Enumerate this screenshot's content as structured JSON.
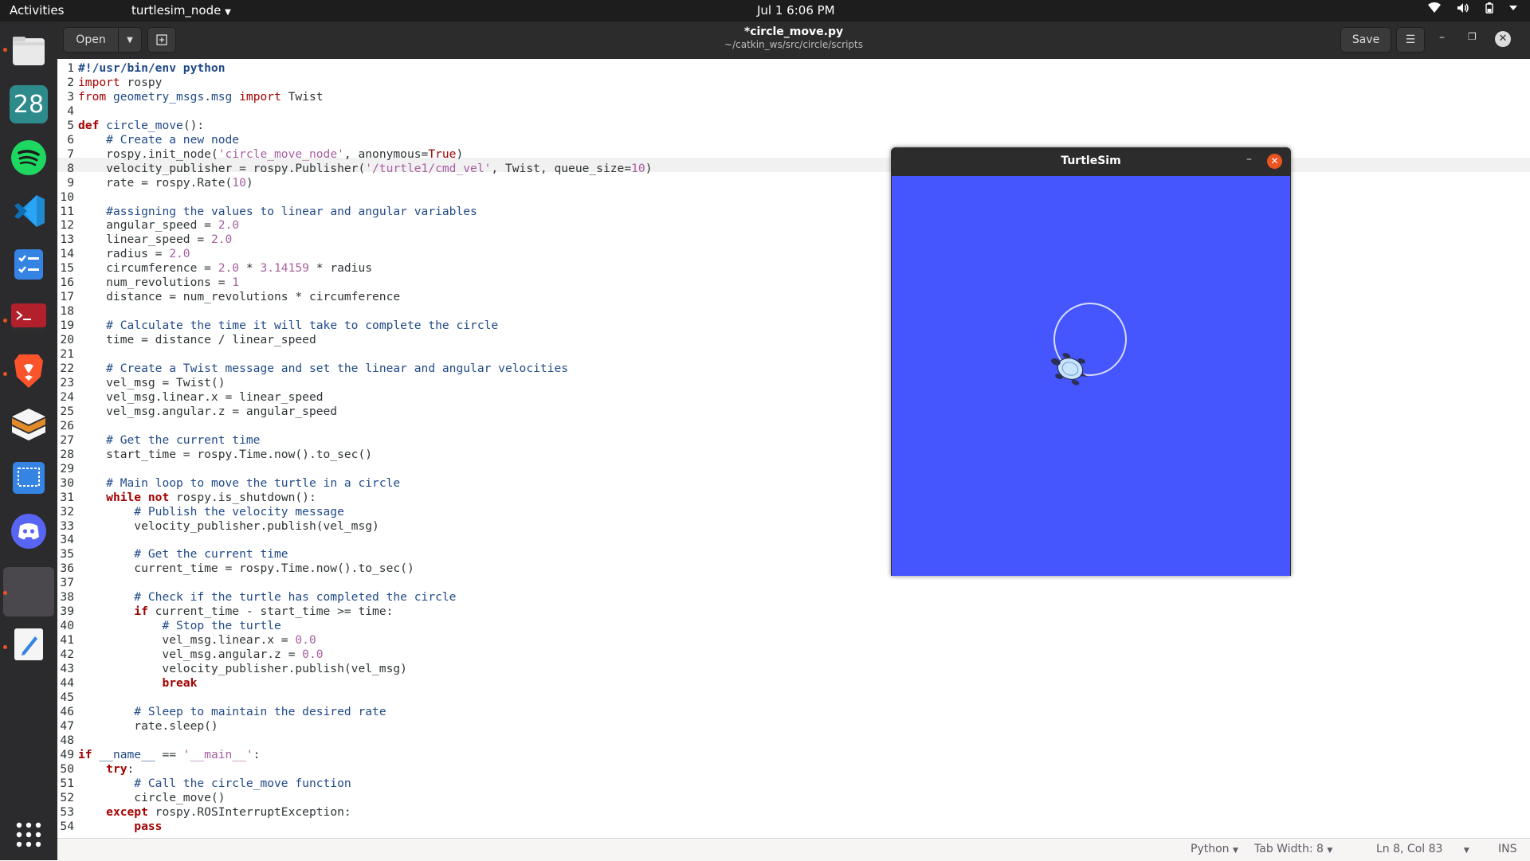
{
  "topbar": {
    "activities": "Activities",
    "app_menu": "turtlesim_node",
    "clock": "Jul 1   6:06 PM"
  },
  "dock": {
    "items": [
      "files-icon",
      "calendar-icon",
      "spotify-icon",
      "vscode-icon",
      "tasks-icon",
      "terminal-icon",
      "brave-icon",
      "sublime-icon",
      "screenshot-icon",
      "discord-icon",
      "blank-app",
      "text-editor-icon"
    ],
    "calendar_day": "28"
  },
  "header": {
    "open_label": "Open",
    "save_label": "Save",
    "file_title": "*circle_move.py",
    "file_path": "~/catkin_ws/src/circle/scripts"
  },
  "editor": {
    "current_line": 8,
    "lines": [
      "#!/usr/bin/env python",
      "import rospy",
      "from geometry_msgs.msg import Twist",
      "",
      "def circle_move():",
      "    # Create a new node",
      "    rospy.init_node('circle_move_node', anonymous=True)",
      "    velocity_publisher = rospy.Publisher('/turtle1/cmd_vel', Twist, queue_size=10)",
      "    rate = rospy.Rate(10)",
      "",
      "    #assigning the values to linear and angular variables",
      "    angular_speed = 2.0",
      "    linear_speed = 2.0",
      "    radius = 2.0",
      "    circumference = 2.0 * 3.14159 * radius",
      "    num_revolutions = 1",
      "    distance = num_revolutions * circumference",
      "",
      "    # Calculate the time it will take to complete the circle",
      "    time = distance / linear_speed",
      "",
      "    # Create a Twist message and set the linear and angular velocities",
      "    vel_msg = Twist()",
      "    vel_msg.linear.x = linear_speed",
      "    vel_msg.angular.z = angular_speed",
      "",
      "    # Get the current time",
      "    start_time = rospy.Time.now().to_sec()",
      "",
      "    # Main loop to move the turtle in a circle",
      "    while not rospy.is_shutdown():",
      "        # Publish the velocity message",
      "        velocity_publisher.publish(vel_msg)",
      "",
      "        # Get the current time",
      "        current_time = rospy.Time.now().to_sec()",
      "",
      "        # Check if the turtle has completed the circle",
      "        if current_time - start_time >= time:",
      "            # Stop the turtle",
      "            vel_msg.linear.x = 0.0",
      "            vel_msg.angular.z = 0.0",
      "            velocity_publisher.publish(vel_msg)",
      "            break",
      "",
      "        # Sleep to maintain the desired rate",
      "        rate.sleep()",
      "",
      "if __name__ == '__main__':",
      "    try:",
      "        # Call the circle_move function",
      "        circle_move()",
      "    except rospy.ROSInterruptException:",
      "        pass"
    ]
  },
  "statusbar": {
    "language": "Python",
    "tab_width": "Tab Width: 8",
    "position": "Ln 8, Col 83",
    "mode": "INS"
  },
  "turtlesim": {
    "title": "TurtleSim",
    "background_color": "#4556ff"
  }
}
